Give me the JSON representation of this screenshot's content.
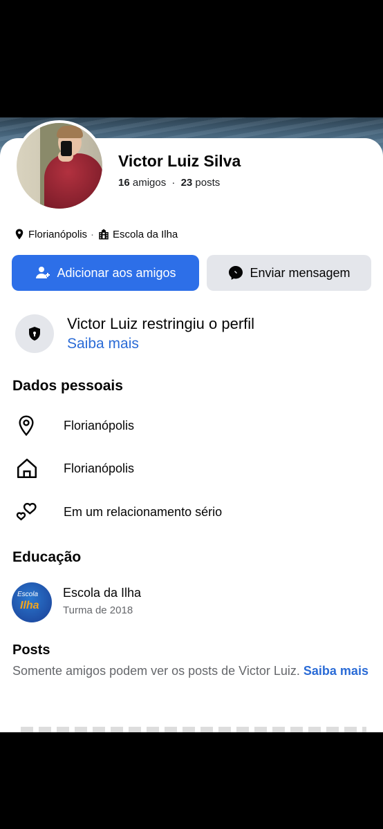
{
  "profile": {
    "name": "Victor Luiz Silva",
    "friends_count": "16",
    "friends_label": "amigos",
    "posts_count": "23",
    "posts_label": "posts",
    "stats_separator": "·",
    "location": "Florianópolis",
    "location_separator": "·",
    "school": "Escola da Ilha"
  },
  "actions": {
    "add_friend_label": "Adicionar aos amigos",
    "message_label": "Enviar mensagem"
  },
  "restricted": {
    "title": "Victor Luiz restringiu o perfil",
    "link": "Saiba mais"
  },
  "personal": {
    "title": "Dados pessoais",
    "items": [
      {
        "icon": "map-pin-icon",
        "text": "Florianópolis"
      },
      {
        "icon": "home-icon",
        "text": "Florianópolis"
      },
      {
        "icon": "hearts-icon",
        "text": "Em um relacionamento sério"
      }
    ]
  },
  "education": {
    "title": "Educação",
    "school_name": "Escola da Ilha",
    "class": "Turma de 2018",
    "logo_text_top": "Escola",
    "logo_text_bottom": "Ilha"
  },
  "posts": {
    "title": "Posts",
    "text": "Somente amigos podem ver os posts de Victor Luiz.",
    "link": "Saiba mais"
  },
  "colors": {
    "primary_blue": "#2d6fe8",
    "link_blue": "#2a6bd6",
    "secondary_button": "#e4e6eb",
    "muted_text": "#65676b"
  }
}
